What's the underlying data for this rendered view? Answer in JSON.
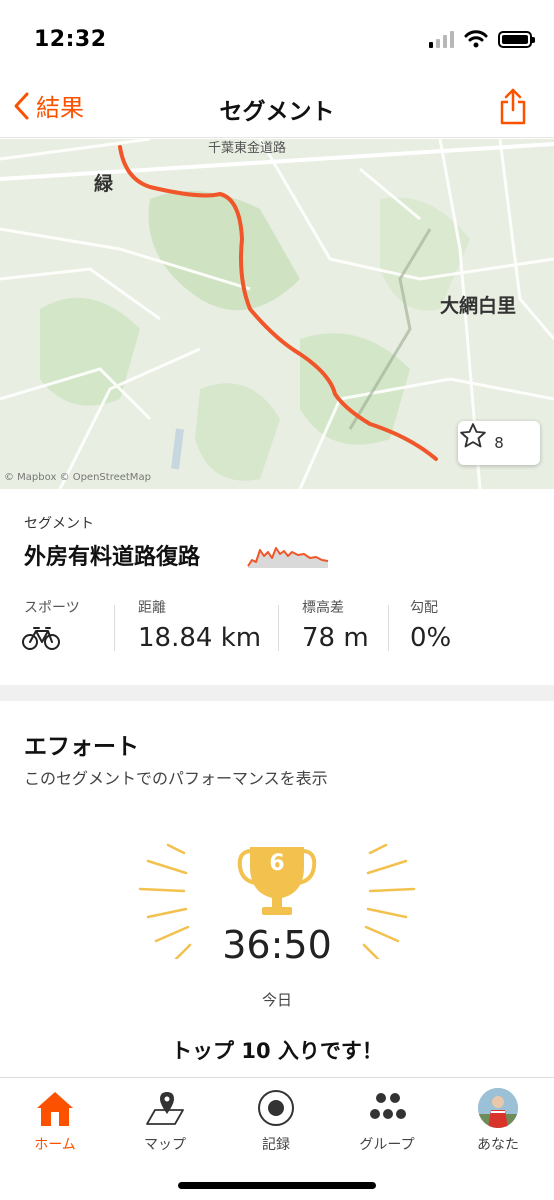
{
  "status": {
    "time": "12:32"
  },
  "nav": {
    "back_label": "結果",
    "title": "セグメント"
  },
  "map": {
    "labels": {
      "town_left": "緑",
      "town_right": "大網白里",
      "road": "千葉東金道路"
    },
    "star_count": "8",
    "attribution": "© Mapbox © OpenStreetMap"
  },
  "segment": {
    "kind_label": "セグメント",
    "name": "外房有料道路復路",
    "stats": [
      {
        "label": "スポーツ",
        "value": ""
      },
      {
        "label": "距離",
        "value": "18.84 km"
      },
      {
        "label": "標高差",
        "value": "78 m"
      },
      {
        "label": "勾配",
        "value": "0%"
      }
    ]
  },
  "effort": {
    "title": "エフォート",
    "subtitle": "このセグメントでのパフォーマンスを表示",
    "rank": "6",
    "time": "36:50",
    "date": "今日",
    "message": "トップ 10 入りです！"
  },
  "tabs": [
    {
      "label": "ホーム",
      "icon": "home-icon",
      "active": true
    },
    {
      "label": "マップ",
      "icon": "map-icon",
      "active": false
    },
    {
      "label": "記録",
      "icon": "record-icon",
      "active": false
    },
    {
      "label": "グループ",
      "icon": "groups-icon",
      "active": false
    },
    {
      "label": "あなた",
      "icon": "avatar",
      "active": false
    }
  ],
  "colors": {
    "accent": "#fc5200",
    "trophy": "#f2c14e",
    "route": "#f0562a"
  }
}
